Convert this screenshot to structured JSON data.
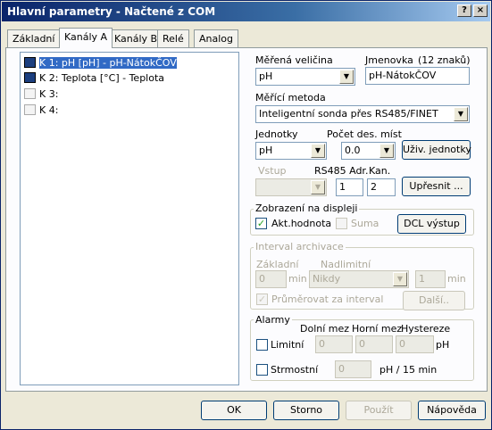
{
  "window": {
    "title": "Hlavní parametry - Načtené z COM",
    "help_glyph": "?",
    "close_glyph": "×"
  },
  "tabs": [
    {
      "label": "Základní"
    },
    {
      "label": "Kanály A"
    },
    {
      "label": "Kanály B"
    },
    {
      "label": "Relé"
    },
    {
      "label": "Analog"
    }
  ],
  "channels": [
    {
      "label": "K 1: pH [pH] -  pH-NátokČOV",
      "state": "selected"
    },
    {
      "label": "K 2: Teplota [°C] -  Teplota",
      "state": "on"
    },
    {
      "label": "K 3:",
      "state": "off"
    },
    {
      "label": "K 4:",
      "state": "off"
    }
  ],
  "form": {
    "measured_qty_label": "Měřená veličina",
    "measured_qty_value": "pH",
    "name_label": "Jmenovka",
    "name_hint": "(12 znaků)",
    "name_value": "pH-NátokČOV",
    "method_label": "Měřící metoda",
    "method_value": "Inteligentní sonda přes RS485/FINET",
    "units_label": "Jednotky",
    "units_value": "pH",
    "decimals_label": "Počet des. míst",
    "decimals_value": "0.0",
    "user_units_button": "Uživ. jednotky",
    "input_label": "Vstup",
    "rs485_label": "RS485 Adr.",
    "rs485_value": "1",
    "channel_label": "Kan.",
    "channel_value": "2",
    "refine_button": "Upřesnit ..."
  },
  "display": {
    "title": "Zobrazení na displeji",
    "current_value_label": "Akt.hodnota",
    "current_value_checked": true,
    "sum_label": "Suma",
    "sum_checked": false,
    "dcl_button": "DCL výstup"
  },
  "archive": {
    "title": "Interval archivace",
    "basic_label": "Základní",
    "basic_value": "0",
    "basic_unit": "min",
    "limit_label": "Nadlimitní",
    "limit_value": "Nikdy",
    "limit_num": "1",
    "limit_unit": "min",
    "average_label": "Průměrovat za interval",
    "average_checked": true,
    "more_button": "Další.."
  },
  "alarms": {
    "title": "Alarmy",
    "lower_label": "Dolní mez",
    "upper_label": "Horní mez",
    "hysteresis_label": "Hystereze",
    "limit_label": "Limitní",
    "limit_checked": false,
    "lower_value": "0",
    "upper_value": "0",
    "hysteresis_value": "0",
    "limit_unit": "pH",
    "steep_label": "Strmostní",
    "steep_checked": false,
    "steep_value": "0",
    "steep_unit": "pH / 15 min"
  },
  "footer": {
    "ok": "OK",
    "cancel": "Storno",
    "apply": "Použít",
    "help": "Nápověda"
  },
  "colors": {
    "selection": "#316ac5",
    "titlebar": "#0a246a",
    "checkmark": "#21a121"
  }
}
